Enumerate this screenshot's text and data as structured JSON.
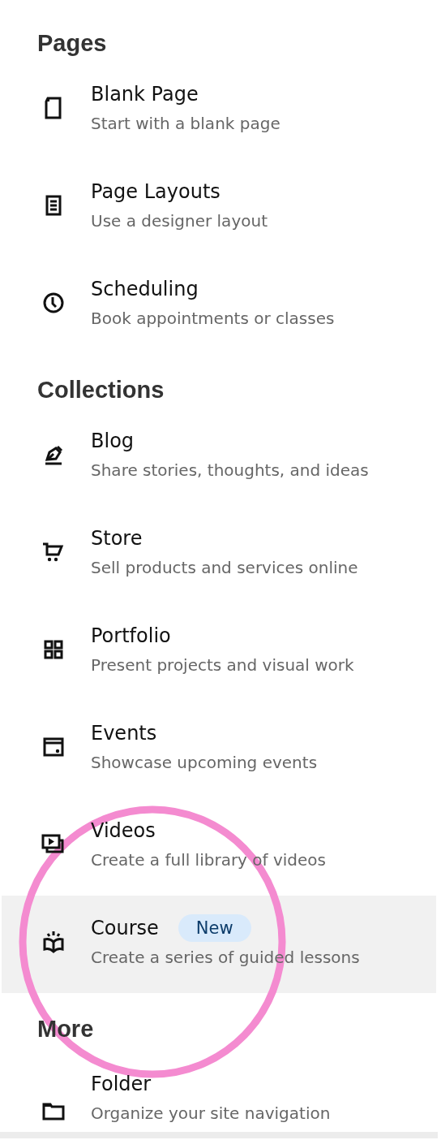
{
  "sections": [
    {
      "title": "Pages",
      "items": [
        {
          "title": "Blank Page",
          "description": "Start with a blank page",
          "selected": false
        },
        {
          "title": "Page Layouts",
          "description": "Use a designer layout",
          "selected": false
        },
        {
          "title": "Scheduling",
          "description": "Book appointments or classes",
          "selected": false
        }
      ]
    },
    {
      "title": "Collections",
      "items": [
        {
          "title": "Blog",
          "description": "Share stories, thoughts, and ideas",
          "selected": false
        },
        {
          "title": "Store",
          "description": "Sell products and services online",
          "selected": false
        },
        {
          "title": "Portfolio",
          "description": "Present projects and visual work",
          "selected": false
        },
        {
          "title": "Events",
          "description": "Showcase upcoming events",
          "selected": false
        },
        {
          "title": "Videos",
          "description": "Create a full library of videos",
          "selected": false
        },
        {
          "title": "Course",
          "badge": "New",
          "description": "Create a series of guided lessons",
          "selected": true
        }
      ]
    },
    {
      "title": "More",
      "items": [
        {
          "title": "Folder",
          "description": "Organize your site navigation",
          "selected": false
        }
      ]
    }
  ]
}
